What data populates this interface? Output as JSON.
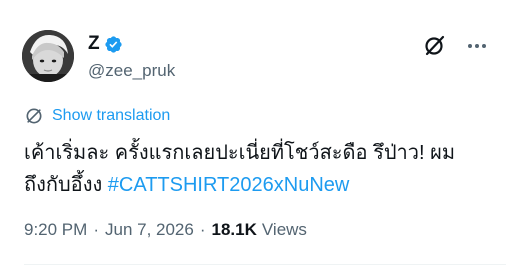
{
  "user": {
    "display_name": "Z",
    "handle": "@zee_pruk",
    "verified": true,
    "avatar_icon": "avatar-photo"
  },
  "actions": {
    "grok_icon": "grok-icon",
    "more_icon": "more-icon"
  },
  "translation": {
    "label": "Show translation",
    "icon": "translate-icon"
  },
  "tweet": {
    "text_line1": "เค้าเริ่มละ ครั้งแรกเลยปะเนี่ยที่โชว์สะดือ รึป่าว! ผม",
    "text_line2_prefix": "ถึงกับอึ้งง ",
    "hashtag": "#CATTSHIRT2026xNuNew"
  },
  "meta": {
    "time": "9:20 PM",
    "date": "Jun 7, 2026",
    "separator": "·",
    "views_count": "18.1K",
    "views_label": "Views"
  },
  "colors": {
    "accent": "#1d9bf0",
    "text_primary": "#0f1419",
    "text_secondary": "#536471"
  }
}
